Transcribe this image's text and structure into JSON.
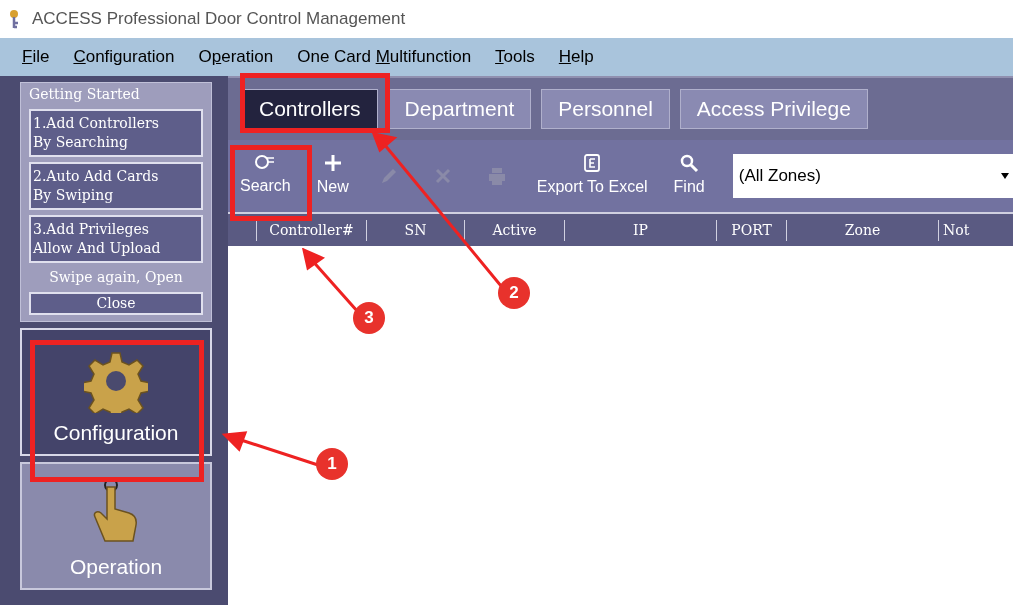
{
  "window": {
    "title": "ACCESS Professional Door Control Management"
  },
  "menu": [
    {
      "key": "F",
      "rest": "ile"
    },
    {
      "key": "C",
      "rest": "onfiguration"
    },
    {
      "pre": "O",
      "key": "p",
      "rest": "eration"
    },
    {
      "pre": "One Card ",
      "key": "M",
      "rest": "ultifunction"
    },
    {
      "key": "T",
      "rest": "ools"
    },
    {
      "key": "H",
      "rest": "elp"
    }
  ],
  "getting_started": {
    "title": "Getting Started",
    "steps": [
      {
        "line1": "1.Add Controllers",
        "line2": "By Searching"
      },
      {
        "line1": "2.Auto Add Cards",
        "line2": "By Swiping"
      },
      {
        "line1": "3.Add Privileges",
        "line2": "Allow And Upload"
      }
    ],
    "note": "Swipe again, Open",
    "close": "Close"
  },
  "modules": [
    {
      "label": "Configuration",
      "kind": "gear",
      "selected": true
    },
    {
      "label": "Operation",
      "kind": "hand",
      "selected": false
    }
  ],
  "tabs": [
    {
      "label": "Controllers",
      "selected": true
    },
    {
      "label": "Department",
      "selected": false
    },
    {
      "label": "Personnel",
      "selected": false
    },
    {
      "label": "Access Privilege",
      "selected": false
    }
  ],
  "toolbar": [
    {
      "kind": "net",
      "label": "Search",
      "disabled": false
    },
    {
      "kind": "plus",
      "label": "New",
      "disabled": false
    },
    {
      "kind": "pencil",
      "disabled": true
    },
    {
      "kind": "cross",
      "disabled": true
    },
    {
      "kind": "printer",
      "disabled": true
    },
    {
      "kind": "excel",
      "label": "Export To Excel",
      "disabled": false
    },
    {
      "kind": "find",
      "label": "Find",
      "disabled": false
    }
  ],
  "zone_select": {
    "value": "(All Zones)"
  },
  "table": {
    "columns": [
      "Controller#",
      "SN",
      "Active",
      "IP",
      "PORT",
      "Zone",
      "Not"
    ]
  },
  "annotations": [
    {
      "number": "1"
    },
    {
      "number": "2"
    },
    {
      "number": "3"
    }
  ]
}
